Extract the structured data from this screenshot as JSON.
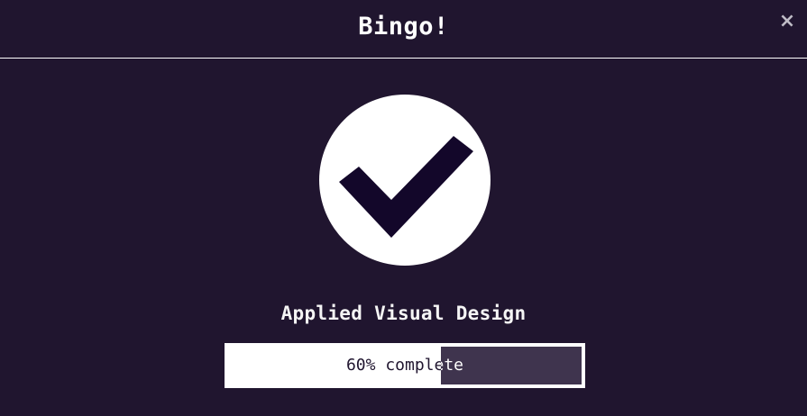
{
  "modal": {
    "title": "Bingo!",
    "close_label": "×"
  },
  "badge": {
    "icon": "check-circle-icon",
    "circle_color": "#ffffff",
    "check_color": "#13072a"
  },
  "challenge": {
    "title": "Applied Visual Design"
  },
  "progress": {
    "percent": 60,
    "label": "60% complete",
    "fill_color": "#ffffff",
    "track_color": "#3f344e"
  },
  "colors": {
    "background": "#20152f",
    "text": "#ffffff"
  }
}
